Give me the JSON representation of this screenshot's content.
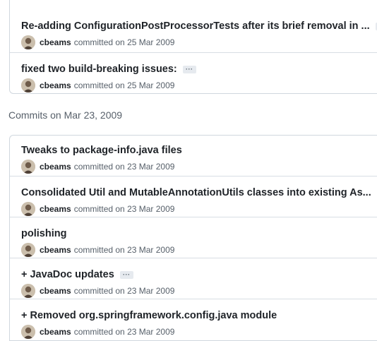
{
  "groups": [
    {
      "heading": "",
      "commits": [
        {
          "title": "Re-adding ConfigurationPostProcessorTests after its brief removal in ...",
          "has_more": true,
          "author": "cbeams",
          "committed": "committed on 25 Mar 2009"
        },
        {
          "title": "fixed two build-breaking issues:",
          "has_more": true,
          "author": "cbeams",
          "committed": "committed on 25 Mar 2009"
        }
      ]
    },
    {
      "heading": "Commits on Mar 23, 2009",
      "commits": [
        {
          "title": "Tweaks to package-info.java files",
          "has_more": false,
          "author": "cbeams",
          "committed": "committed on 23 Mar 2009"
        },
        {
          "title": "Consolidated Util and MutableAnnotationUtils classes into existing As...",
          "has_more": true,
          "author": "cbeams",
          "committed": "committed on 23 Mar 2009"
        },
        {
          "title": "polishing",
          "has_more": false,
          "author": "cbeams",
          "committed": "committed on 23 Mar 2009"
        },
        {
          "title": "+ JavaDoc updates",
          "has_more": true,
          "author": "cbeams",
          "committed": "committed on 23 Mar 2009"
        },
        {
          "title": "+ Removed org.springframework.config.java module",
          "has_more": false,
          "author": "cbeams",
          "committed": "committed on 23 Mar 2009"
        }
      ]
    }
  ],
  "expand_label": "···",
  "icons": {
    "avatar": "user-avatar-icon",
    "expand": "ellipsis-icon"
  }
}
